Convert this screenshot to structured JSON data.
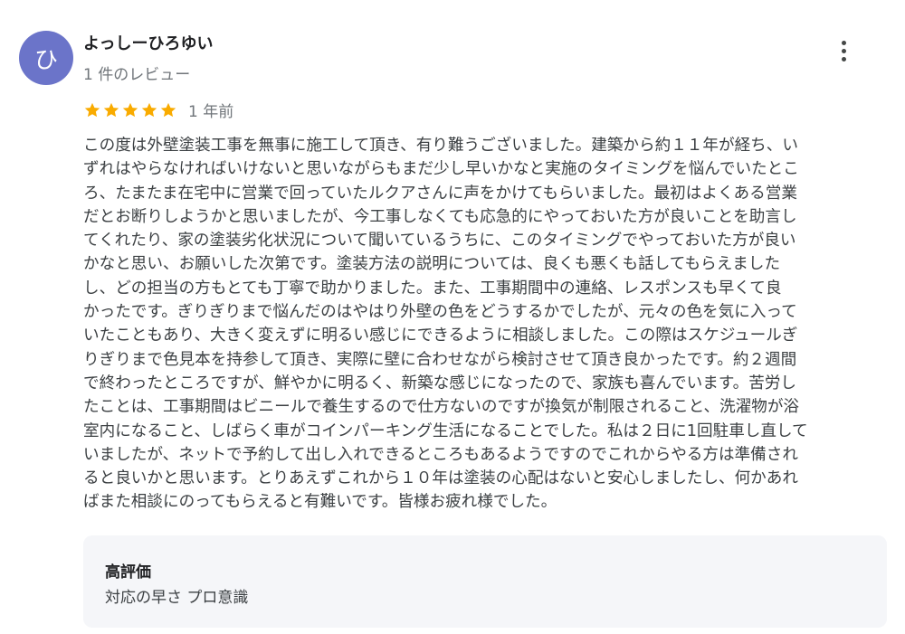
{
  "reviewer": {
    "avatar_letter": "ひ",
    "avatar_color": "#6b74c9",
    "name": "よっしーひろゆい",
    "review_count": "1 件のレビュー"
  },
  "more_icon": "more-vertical-icon",
  "rating": {
    "stars": 5,
    "max_stars": 5,
    "star_color": "#f9ab00",
    "time_ago": "1 年前"
  },
  "review": {
    "text": "この度は外壁塗装工事を無事に施工して頂き、有り難うございました。建築から約１１年が経ち、い\nずれはやらなければいけないと思いながらもまだ少し早いかなと実施のタイミングを悩んでいたとこ\nろ、たまたま在宅中に営業で回っていたルクアさんに声をかけてもらいました。最初はよくある営業\nだとお断りしようかと思いましたが、今工事しなくても応急的にやっておいた方が良いことを助言し\nてくれたり、家の塗装劣化状況について聞いているうちに、このタイミングでやっておいた方が良い\nかなと思い、お願いした次第です。塗装方法の説明については、良くも悪くも話してもらえました\nし、どの担当の方もとても丁寧で助かりました。また、工事期間中の連絡、レスポンスも早くて良\nかったです。ぎりぎりまで悩んだのはやはり外壁の色をどうするかでしたが、元々の色を気に入って\nいたこともあり、大きく変えずに明るい感じにできるように相談しました。この際はスケジュールぎ\nりぎりまで色見本を持参して頂き、実際に壁に合わせながら検討させて頂き良かったです。約２週間\nで終わったところですが、鮮やかに明るく、新築な感じになったので、家族も喜んでいます。苦労し\nたことは、工事期間はビニールで養生するので仕方ないのですが換気が制限されること、洗濯物が浴\n室内になること、しばらく車がコインパーキング生活になることでした。私は２日に1回駐車し直して\nいましたが、ネットで予約して出し入れできるところもあるようですのでこれからやる方は準備され\nると良いかと思います。とりあえずこれから１０年は塗装の心配はないと安心しましたし、何かあれ\nばまた相談にのってもらえると有難いです。皆様お疲れ様でした。"
  },
  "highlights": {
    "title": "高評価",
    "tags": "対応の早さ プロ意識",
    "background": "#f5f6f9"
  }
}
